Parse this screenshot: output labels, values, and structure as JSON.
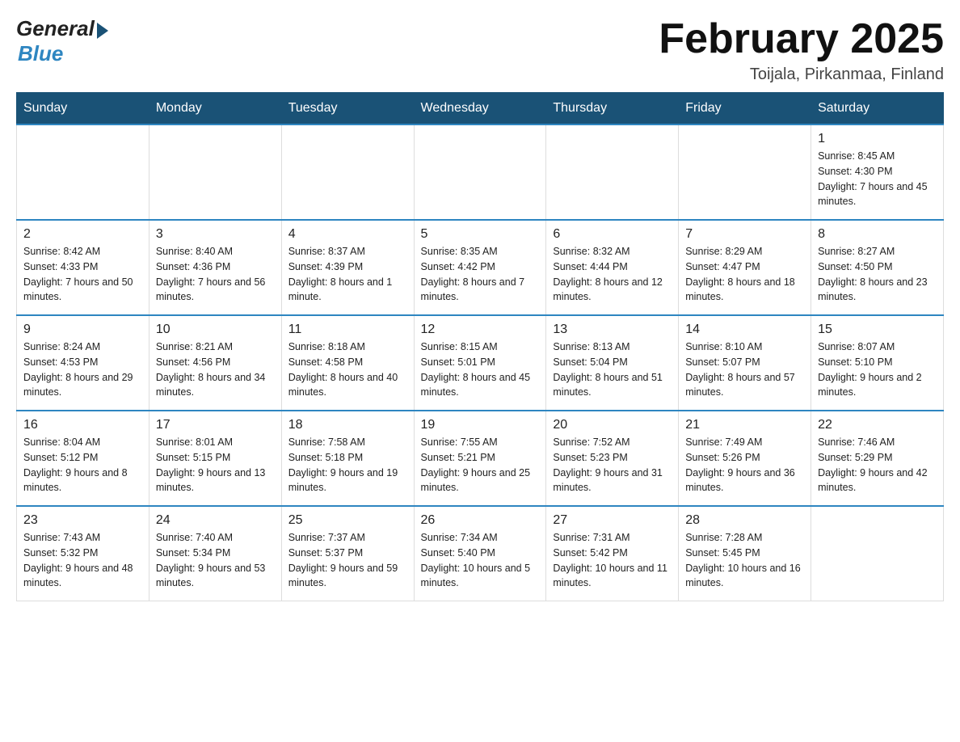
{
  "header": {
    "logo_general": "General",
    "logo_blue": "Blue",
    "month_title": "February 2025",
    "location": "Toijala, Pirkanmaa, Finland"
  },
  "weekdays": [
    "Sunday",
    "Monday",
    "Tuesday",
    "Wednesday",
    "Thursday",
    "Friday",
    "Saturday"
  ],
  "weeks": [
    [
      {
        "day": "",
        "info": ""
      },
      {
        "day": "",
        "info": ""
      },
      {
        "day": "",
        "info": ""
      },
      {
        "day": "",
        "info": ""
      },
      {
        "day": "",
        "info": ""
      },
      {
        "day": "",
        "info": ""
      },
      {
        "day": "1",
        "info": "Sunrise: 8:45 AM\nSunset: 4:30 PM\nDaylight: 7 hours and 45 minutes."
      }
    ],
    [
      {
        "day": "2",
        "info": "Sunrise: 8:42 AM\nSunset: 4:33 PM\nDaylight: 7 hours and 50 minutes."
      },
      {
        "day": "3",
        "info": "Sunrise: 8:40 AM\nSunset: 4:36 PM\nDaylight: 7 hours and 56 minutes."
      },
      {
        "day": "4",
        "info": "Sunrise: 8:37 AM\nSunset: 4:39 PM\nDaylight: 8 hours and 1 minute."
      },
      {
        "day": "5",
        "info": "Sunrise: 8:35 AM\nSunset: 4:42 PM\nDaylight: 8 hours and 7 minutes."
      },
      {
        "day": "6",
        "info": "Sunrise: 8:32 AM\nSunset: 4:44 PM\nDaylight: 8 hours and 12 minutes."
      },
      {
        "day": "7",
        "info": "Sunrise: 8:29 AM\nSunset: 4:47 PM\nDaylight: 8 hours and 18 minutes."
      },
      {
        "day": "8",
        "info": "Sunrise: 8:27 AM\nSunset: 4:50 PM\nDaylight: 8 hours and 23 minutes."
      }
    ],
    [
      {
        "day": "9",
        "info": "Sunrise: 8:24 AM\nSunset: 4:53 PM\nDaylight: 8 hours and 29 minutes."
      },
      {
        "day": "10",
        "info": "Sunrise: 8:21 AM\nSunset: 4:56 PM\nDaylight: 8 hours and 34 minutes."
      },
      {
        "day": "11",
        "info": "Sunrise: 8:18 AM\nSunset: 4:58 PM\nDaylight: 8 hours and 40 minutes."
      },
      {
        "day": "12",
        "info": "Sunrise: 8:15 AM\nSunset: 5:01 PM\nDaylight: 8 hours and 45 minutes."
      },
      {
        "day": "13",
        "info": "Sunrise: 8:13 AM\nSunset: 5:04 PM\nDaylight: 8 hours and 51 minutes."
      },
      {
        "day": "14",
        "info": "Sunrise: 8:10 AM\nSunset: 5:07 PM\nDaylight: 8 hours and 57 minutes."
      },
      {
        "day": "15",
        "info": "Sunrise: 8:07 AM\nSunset: 5:10 PM\nDaylight: 9 hours and 2 minutes."
      }
    ],
    [
      {
        "day": "16",
        "info": "Sunrise: 8:04 AM\nSunset: 5:12 PM\nDaylight: 9 hours and 8 minutes."
      },
      {
        "day": "17",
        "info": "Sunrise: 8:01 AM\nSunset: 5:15 PM\nDaylight: 9 hours and 13 minutes."
      },
      {
        "day": "18",
        "info": "Sunrise: 7:58 AM\nSunset: 5:18 PM\nDaylight: 9 hours and 19 minutes."
      },
      {
        "day": "19",
        "info": "Sunrise: 7:55 AM\nSunset: 5:21 PM\nDaylight: 9 hours and 25 minutes."
      },
      {
        "day": "20",
        "info": "Sunrise: 7:52 AM\nSunset: 5:23 PM\nDaylight: 9 hours and 31 minutes."
      },
      {
        "day": "21",
        "info": "Sunrise: 7:49 AM\nSunset: 5:26 PM\nDaylight: 9 hours and 36 minutes."
      },
      {
        "day": "22",
        "info": "Sunrise: 7:46 AM\nSunset: 5:29 PM\nDaylight: 9 hours and 42 minutes."
      }
    ],
    [
      {
        "day": "23",
        "info": "Sunrise: 7:43 AM\nSunset: 5:32 PM\nDaylight: 9 hours and 48 minutes."
      },
      {
        "day": "24",
        "info": "Sunrise: 7:40 AM\nSunset: 5:34 PM\nDaylight: 9 hours and 53 minutes."
      },
      {
        "day": "25",
        "info": "Sunrise: 7:37 AM\nSunset: 5:37 PM\nDaylight: 9 hours and 59 minutes."
      },
      {
        "day": "26",
        "info": "Sunrise: 7:34 AM\nSunset: 5:40 PM\nDaylight: 10 hours and 5 minutes."
      },
      {
        "day": "27",
        "info": "Sunrise: 7:31 AM\nSunset: 5:42 PM\nDaylight: 10 hours and 11 minutes."
      },
      {
        "day": "28",
        "info": "Sunrise: 7:28 AM\nSunset: 5:45 PM\nDaylight: 10 hours and 16 minutes."
      },
      {
        "day": "",
        "info": ""
      }
    ]
  ]
}
